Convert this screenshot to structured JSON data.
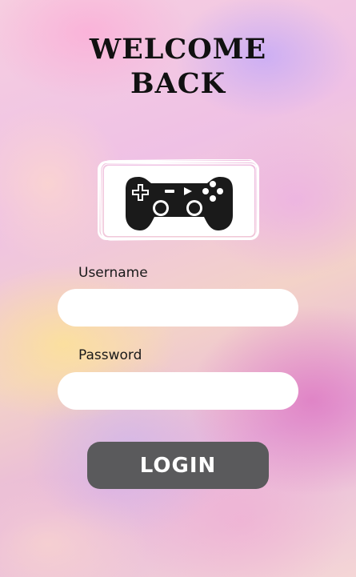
{
  "header": {
    "title_line1": "WELCOME",
    "title_line2": "BACK"
  },
  "logo": {
    "icon": "gamepad-icon"
  },
  "form": {
    "username_label": "Username",
    "username_value": "",
    "password_label": "Password",
    "password_value": "",
    "login_label": "LOGIN"
  },
  "colors": {
    "title_text": "#111111",
    "button_bg": "#5a5a5c",
    "button_text": "#ffffff",
    "field_bg": "#ffffff"
  }
}
